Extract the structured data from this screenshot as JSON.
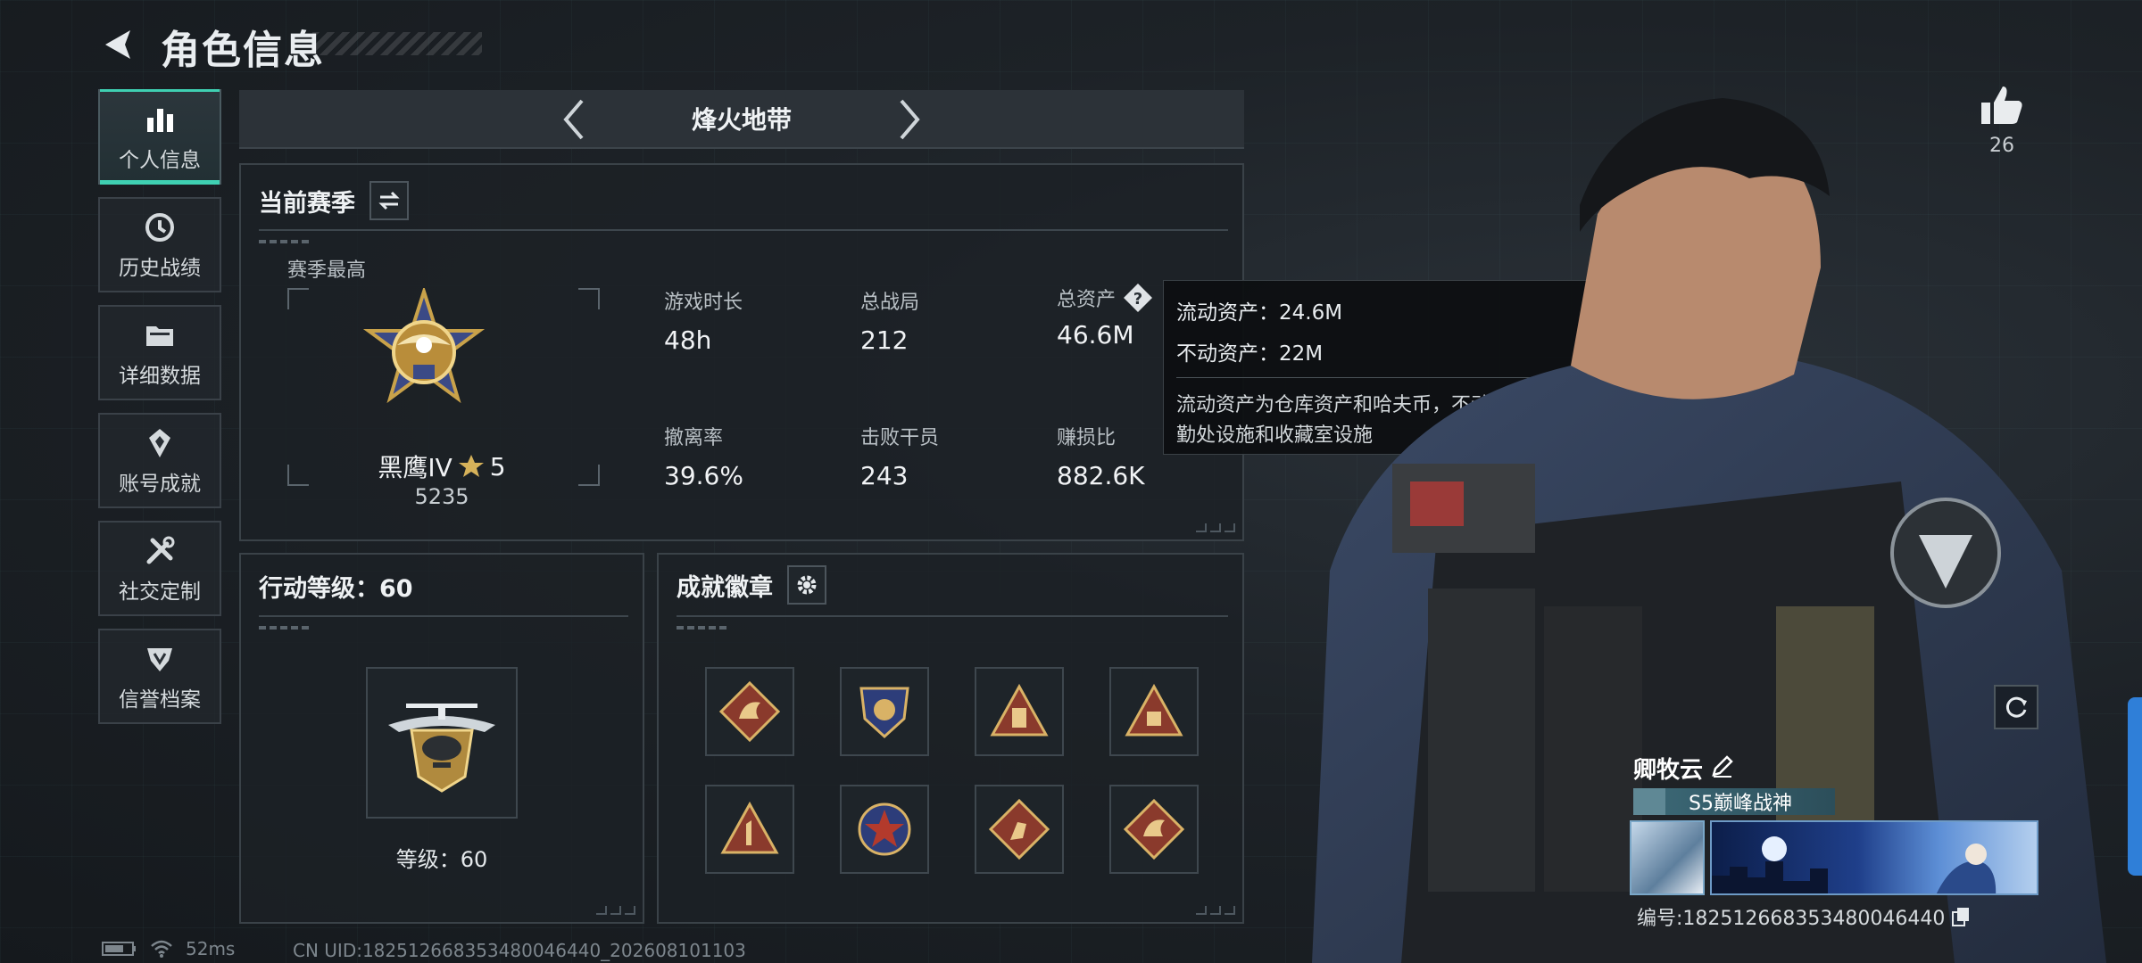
{
  "header": {
    "title": "角色信息"
  },
  "sidebar": {
    "items": [
      {
        "label": "个人信息"
      },
      {
        "label": "历史战绩"
      },
      {
        "label": "详细数据"
      },
      {
        "label": "账号成就"
      },
      {
        "label": "社交定制"
      },
      {
        "label": "信誉档案"
      }
    ]
  },
  "season_selector": {
    "name": "烽火地带"
  },
  "current_season": {
    "title": "当前赛季",
    "best_label": "赛季最高",
    "rank_name": "黑鹰IV",
    "rank_stars": "5",
    "rank_score": "5235",
    "stats": [
      {
        "label": "游戏时长",
        "value": "48h"
      },
      {
        "label": "总战局",
        "value": "212"
      },
      {
        "label": "总资产",
        "value": "46.6M"
      },
      {
        "label": "撤离率",
        "value": "39.6%"
      },
      {
        "label": "击败干员",
        "value": "243"
      },
      {
        "label": "赚损比",
        "value": "882.6K"
      }
    ]
  },
  "tooltip": {
    "liquid": "流动资产：24.6M",
    "fixed": "不动资产：22M",
    "description": "流动资产为仓库资产和哈夫币，不动资产为特勤处设施和收藏室设施"
  },
  "action_level": {
    "title": "行动等级：60",
    "level_label": "等级：60"
  },
  "achievements": {
    "title": "成就徽章"
  },
  "character": {
    "likes": "26",
    "name": "卿牧云",
    "title_badge": "S5巅峰战神",
    "player_id": "编号:1825126683534800464​40"
  },
  "status": {
    "ping": "52ms",
    "uid": "CN UID:18251266835348004644​0_202608101103"
  },
  "colors": {
    "accent": "#3fd0b2",
    "panel": "#1c2126",
    "gold": "#c9a24a"
  }
}
